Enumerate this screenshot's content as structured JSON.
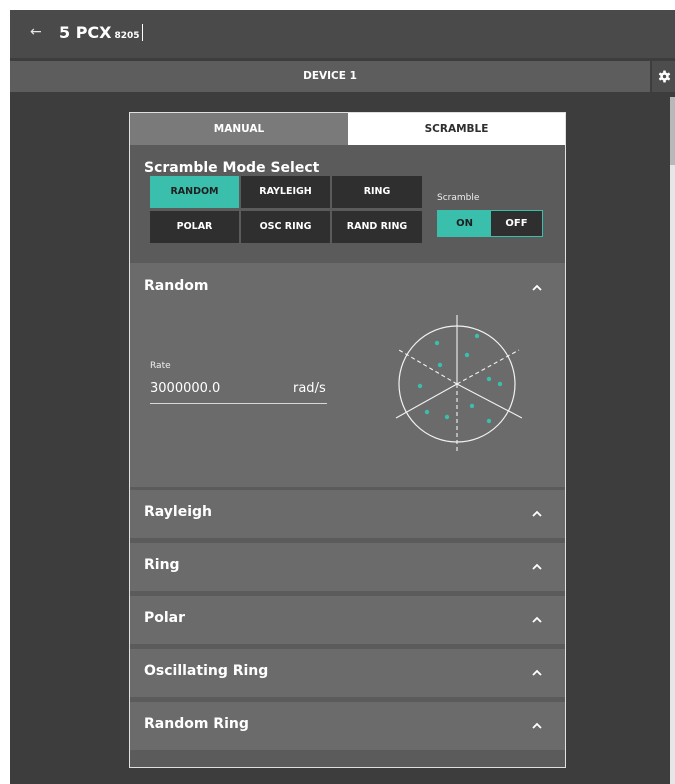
{
  "header": {
    "title": "5 PCX",
    "subtitle": "8205"
  },
  "device": {
    "label": "DEVICE 1"
  },
  "tabs": {
    "manual": "MANUAL",
    "scramble": "SCRAMBLE"
  },
  "mode_select": {
    "title": "Scramble Mode Select",
    "buttons": [
      "RANDOM",
      "RAYLEIGH",
      "RING",
      "POLAR",
      "OSC RING",
      "RAND RING"
    ],
    "active": "RANDOM"
  },
  "scramble_toggle": {
    "label": "Scramble",
    "on": "ON",
    "off": "OFF",
    "state": "ON"
  },
  "sections": {
    "random": {
      "title": "Random",
      "rate_label": "Rate",
      "rate_value": "3000000.0",
      "rate_unit": "rad/s"
    },
    "rayleigh": {
      "title": "Rayleigh"
    },
    "ring": {
      "title": "Ring"
    },
    "polar": {
      "title": "Polar"
    },
    "osc_ring": {
      "title": "Oscillating Ring"
    },
    "random_ring": {
      "title": "Random Ring"
    }
  },
  "colors": {
    "accent": "#3bbfad",
    "background": "#3d3d3d",
    "panel": "#5b5b5b",
    "section": "#6b6b6b",
    "button": "#2f2f2f"
  },
  "icons": {
    "back": "back-arrow-icon",
    "settings": "gear-icon",
    "collapse": "chevron-up-icon"
  }
}
